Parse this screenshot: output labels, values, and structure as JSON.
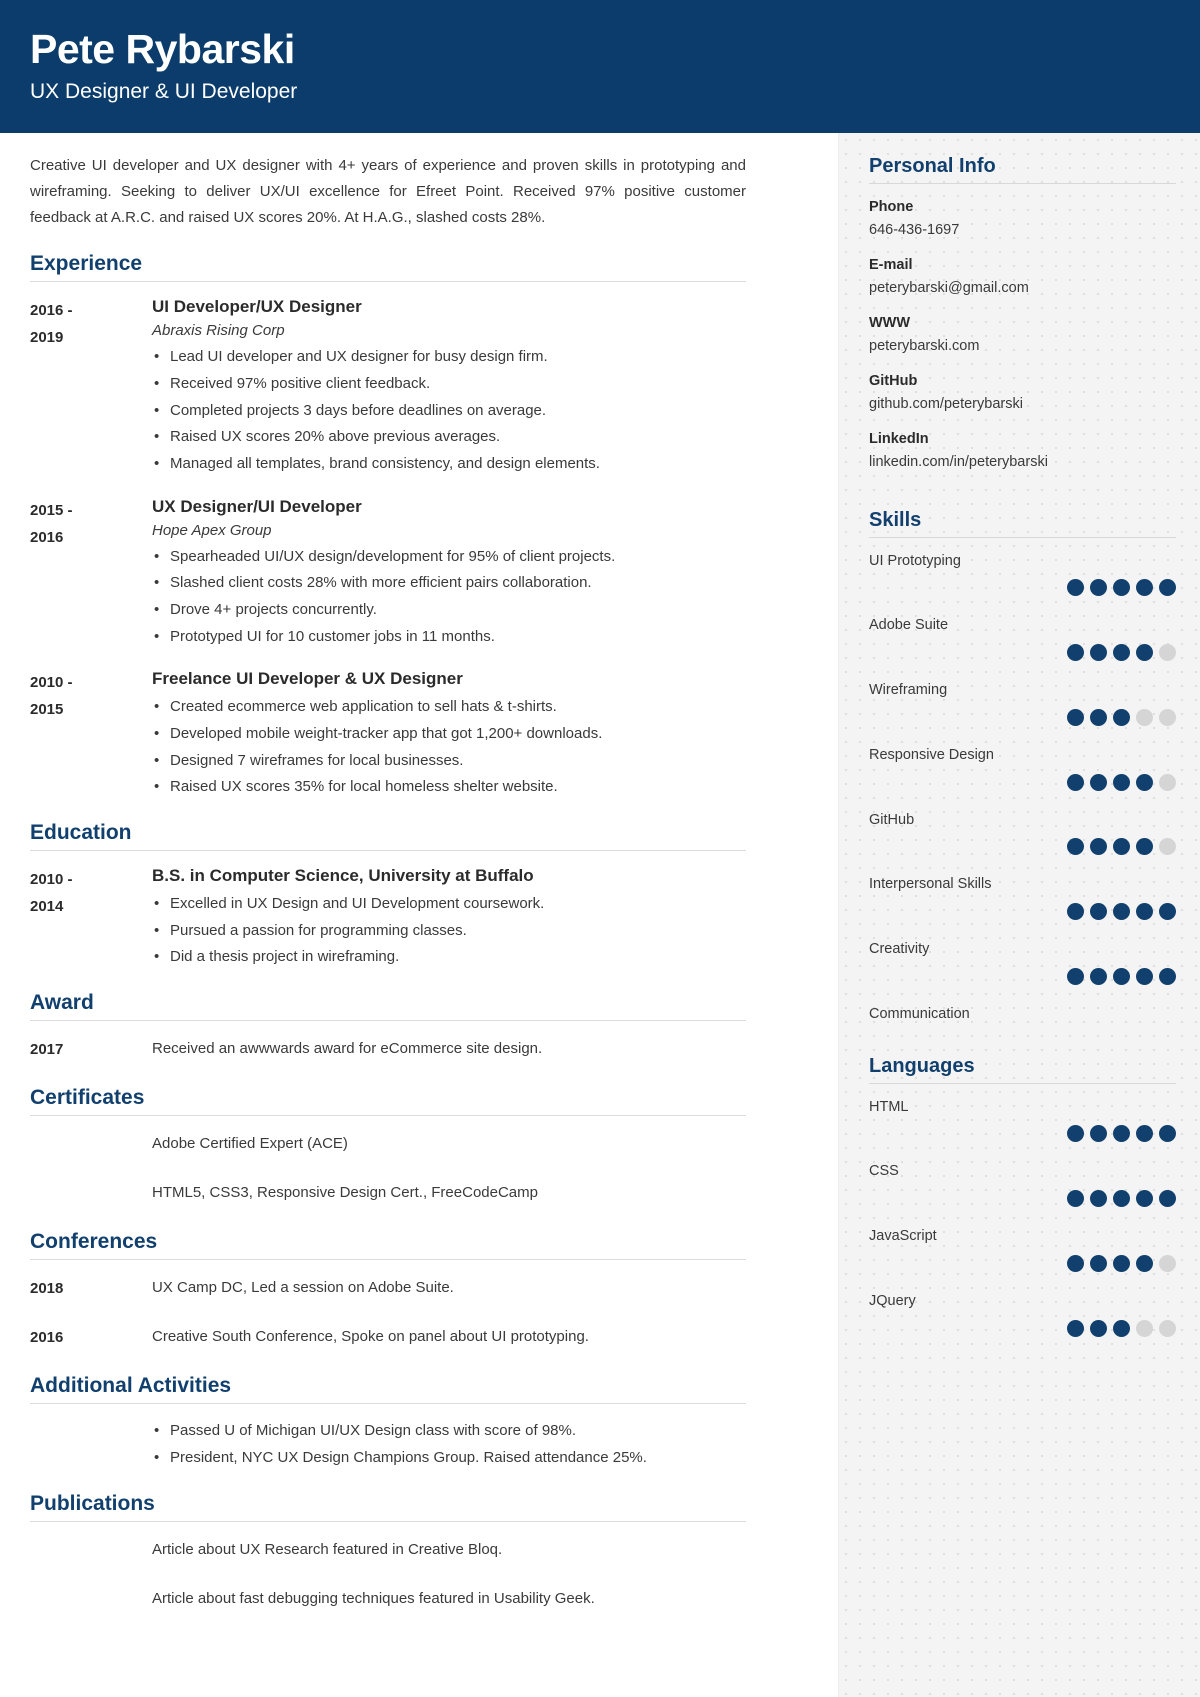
{
  "colors": {
    "header_bg": "#0b3c6b",
    "heading": "#12406e",
    "sidebar_bg": "#f4f4f4",
    "dot_on": "#12406e",
    "dot_off": "#d5d5d5"
  },
  "header": {
    "name": "Pete Rybarski",
    "title": "UX Designer & UI Developer"
  },
  "summary": "Creative UI developer and UX designer with 4+ years of experience and proven skills in prototyping and wireframing. Seeking to deliver UX/UI excellence for Efreet Point. Received 97% positive customer feedback at A.R.C. and raised UX scores 20%. At H.A.G., slashed costs 28%.",
  "sections": {
    "experience": {
      "heading": "Experience",
      "entries": [
        {
          "years_from": "2016 -",
          "years_to": "2019",
          "title": "UI Developer/UX Designer",
          "org": "Abraxis Rising Corp",
          "bullets": [
            "Lead UI developer and UX designer for busy design firm.",
            "Received 97% positive client feedback.",
            "Completed projects 3 days before deadlines on average.",
            "Raised UX scores 20% above previous averages.",
            "Managed all templates, brand consistency, and design elements."
          ]
        },
        {
          "years_from": "2015 -",
          "years_to": "2016",
          "title": "UX Designer/UI Developer",
          "org": "Hope Apex Group",
          "bullets": [
            "Spearheaded UI/UX design/development for 95% of client projects.",
            "Slashed client costs 28% with more efficient pairs collaboration.",
            "Drove 4+ projects concurrently.",
            "Prototyped UI for 10 customer jobs in 11 months."
          ]
        },
        {
          "years_from": "2010 -",
          "years_to": "2015",
          "title": "Freelance UI Developer & UX Designer",
          "org": "",
          "bullets": [
            "Created ecommerce web application to sell hats & t-shirts.",
            "Developed mobile weight-tracker app that got 1,200+ downloads.",
            "Designed 7 wireframes for local businesses.",
            "Raised UX scores 35% for local homeless shelter website."
          ]
        }
      ]
    },
    "education": {
      "heading": "Education",
      "entries": [
        {
          "years_from": "2010 -",
          "years_to": "2014",
          "title": "B.S. in Computer Science, University at Buffalo",
          "org": "",
          "bullets": [
            "Excelled in UX Design and UI Development coursework.",
            "Pursued a passion for programming classes.",
            "Did a thesis project in wireframing."
          ]
        }
      ]
    },
    "award": {
      "heading": "Award",
      "entries": [
        {
          "years_from": "2017",
          "years_to": "",
          "text": "Received an awwwards award for eCommerce site design."
        }
      ]
    },
    "certificates": {
      "heading": "Certificates",
      "entries": [
        {
          "years_from": "",
          "years_to": "",
          "text": "Adobe Certified Expert (ACE)"
        },
        {
          "years_from": "",
          "years_to": "",
          "text": "HTML5, CSS3, Responsive Design Cert., FreeCodeCamp"
        }
      ]
    },
    "conferences": {
      "heading": "Conferences",
      "entries": [
        {
          "years_from": "2018",
          "years_to": "",
          "text": "UX Camp DC, Led a session on Adobe Suite."
        },
        {
          "years_from": "2016",
          "years_to": "",
          "text": "Creative South Conference, Spoke on panel about UI prototyping."
        }
      ]
    },
    "activities": {
      "heading": "Additional Activities",
      "bullets": [
        "Passed U of Michigan UI/UX Design class with score of 98%.",
        "President, NYC UX Design Champions Group. Raised attendance 25%."
      ]
    },
    "publications": {
      "heading": "Publications",
      "entries": [
        {
          "text": "Article about UX Research featured in Creative Bloq."
        },
        {
          "text": "Article about fast debugging techniques featured in Usability Geek."
        }
      ]
    }
  },
  "sidebar": {
    "personal_info": {
      "heading": "Personal Info",
      "items": [
        {
          "label": "Phone",
          "value": "646-436-1697"
        },
        {
          "label": "E-mail",
          "value": "peterybarski@gmail.com"
        },
        {
          "label": "WWW",
          "value": "peterybarski.com"
        },
        {
          "label": "GitHub",
          "value": "github.com/peterybarski"
        },
        {
          "label": "LinkedIn",
          "value": "linkedin.com/in/peterybarski"
        }
      ]
    },
    "skills": {
      "heading": "Skills",
      "max": 5,
      "items": [
        {
          "label": "UI Prototyping",
          "rating": 5
        },
        {
          "label": "Adobe Suite",
          "rating": 4
        },
        {
          "label": "Wireframing",
          "rating": 3
        },
        {
          "label": "Responsive Design",
          "rating": 4
        },
        {
          "label": "GitHub",
          "rating": 4
        },
        {
          "label": "Interpersonal Skills",
          "rating": 5
        },
        {
          "label": "Creativity",
          "rating": 5
        },
        {
          "label": "Communication",
          "rating": 0
        }
      ]
    },
    "languages": {
      "heading": "Languages",
      "max": 5,
      "items": [
        {
          "label": "HTML",
          "rating": 5
        },
        {
          "label": "CSS",
          "rating": 5
        },
        {
          "label": "JavaScript",
          "rating": 4
        },
        {
          "label": "JQuery",
          "rating": 3
        }
      ]
    }
  }
}
